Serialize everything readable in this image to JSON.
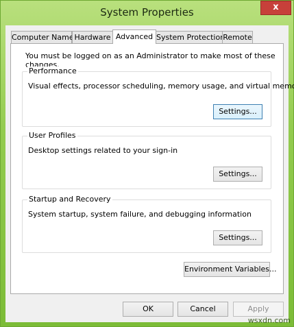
{
  "window": {
    "title": "System Properties",
    "close_glyph": "x"
  },
  "tabs": [
    {
      "label": "Computer Name",
      "active": false
    },
    {
      "label": "Hardware",
      "active": false
    },
    {
      "label": "Advanced",
      "active": true
    },
    {
      "label": "System Protection",
      "active": false
    },
    {
      "label": "Remote",
      "active": false
    }
  ],
  "advanced": {
    "admin_note": "You must be logged on as an Administrator to make most of these changes.",
    "performance": {
      "title": "Performance",
      "description": "Visual effects, processor scheduling, memory usage, and virtual memory",
      "button": "Settings..."
    },
    "user_profiles": {
      "title": "User Profiles",
      "description": "Desktop settings related to your sign-in",
      "button": "Settings..."
    },
    "startup_recovery": {
      "title": "Startup and Recovery",
      "description": "System startup, system failure, and debugging information",
      "button": "Settings..."
    },
    "env_button": "Environment Variables..."
  },
  "footer": {
    "ok": "OK",
    "cancel": "Cancel",
    "apply": "Apply"
  },
  "watermark": "wsxdn.com"
}
